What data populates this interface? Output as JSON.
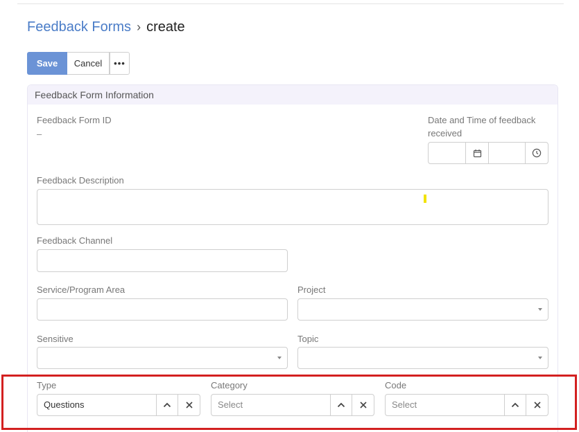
{
  "breadcrumb": {
    "parent": "Feedback Forms",
    "separator": "›",
    "current": "create"
  },
  "toolbar": {
    "save_label": "Save",
    "cancel_label": "Cancel",
    "more_label": "•••"
  },
  "panel": {
    "title": "Feedback Form Information"
  },
  "fields": {
    "feedback_form_id": {
      "label": "Feedback Form ID",
      "value": "–"
    },
    "date_time": {
      "label_line1": "Date and Time of feedback",
      "label_line2": "received"
    },
    "description": {
      "label": "Feedback Description"
    },
    "channel": {
      "label": "Feedback Channel"
    },
    "service_area": {
      "label": "Service/Program Area"
    },
    "project": {
      "label": "Project"
    },
    "sensitive": {
      "label": "Sensitive"
    },
    "topic": {
      "label": "Topic"
    },
    "type": {
      "label": "Type",
      "value": "Questions"
    },
    "category": {
      "label": "Category",
      "placeholder": "Select"
    },
    "code": {
      "label": "Code",
      "placeholder": "Select"
    }
  },
  "colors": {
    "accent": "#6b93d6",
    "link": "#4a7cc7",
    "highlight": "#d32020"
  },
  "icons": [
    "calendar-icon",
    "clock-icon",
    "chevron-up-icon",
    "close-icon",
    "caret-down-icon"
  ]
}
